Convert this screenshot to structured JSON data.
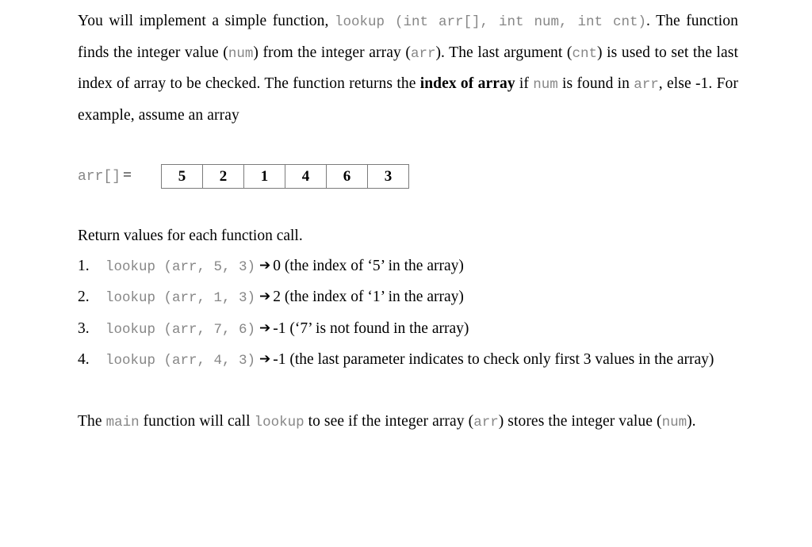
{
  "document": {
    "intro": {
      "line1_pre": "You will implement a simple function, ",
      "line1_code": "lookup (int arr[], int num, int cnt)",
      "line1_post": ".",
      "seg1": "The function finds the integer value (",
      "code_num": "num",
      "seg2": ") from the integer array (",
      "code_arr": "arr",
      "seg3": "). The last argument (",
      "code_cnt": "cnt",
      "seg4": ") is used to set the last index of array to be checked. The function returns the ",
      "bold_phrase": "index of array",
      "seg5": " if ",
      "code_num2": "num",
      "seg6": " is found in ",
      "code_arr2": "arr",
      "seg7": ", else -1. For example, assume an array"
    },
    "array_example": {
      "label_code": "arr[]",
      "label_eq": "=",
      "values": [
        "5",
        "2",
        "1",
        "4",
        "6",
        "3"
      ]
    },
    "return_section": {
      "title": "Return values for each function call.",
      "arrow_glyph": "➔",
      "items": [
        {
          "number": "1.",
          "code": "lookup (arr, 5, 3)",
          "result": "0 (the index of ‘5’ in the array)"
        },
        {
          "number": "2.",
          "code": "lookup (arr, 1, 3)",
          "result": "2 (the index of ‘1’ in the array)"
        },
        {
          "number": "3.",
          "code": "lookup (arr, 7, 6)",
          "result": "-1 (‘7’ is not found in the array)"
        },
        {
          "number": "4.",
          "code": "lookup (arr, 4, 3)",
          "result": "-1 (the last parameter indicates to check only first 3 values in the array)"
        }
      ]
    },
    "closing": {
      "seg1": "The ",
      "code_main": "main",
      "seg2": " function will call ",
      "code_lookup": "lookup",
      "seg3": " to see if the integer array (",
      "code_arr": "arr",
      "seg4": ") stores the integer value (",
      "code_num": "num",
      "seg5": ")."
    }
  }
}
